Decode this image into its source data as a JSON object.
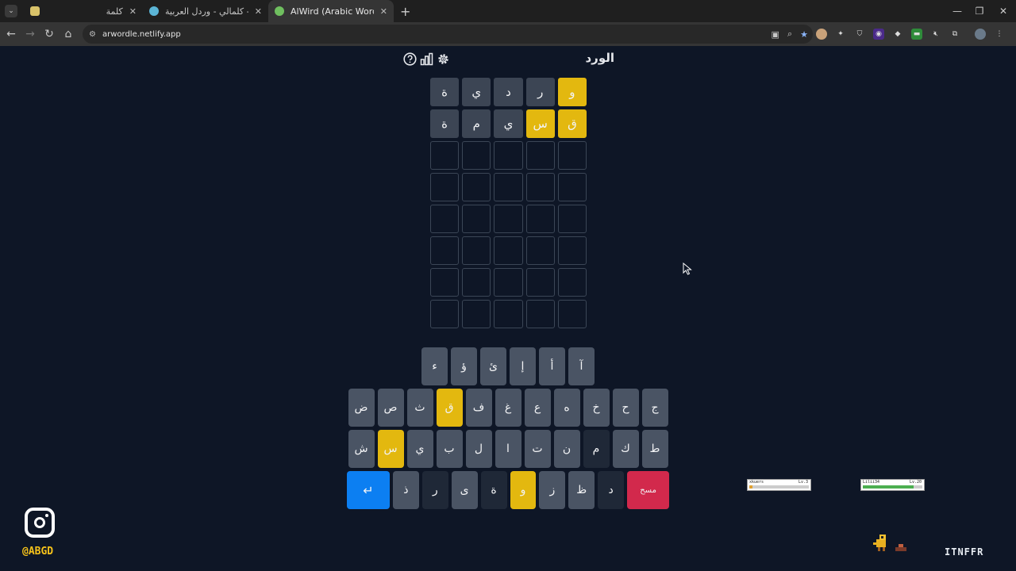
{
  "browser": {
    "tabs": [
      {
        "title": "كلمة",
        "favicon_color": "#d9c36a",
        "active": false
      },
      {
        "title": "كلمالي - وردل العربية - aly.com",
        "favicon_color": "#5bb5d6",
        "active": false
      },
      {
        "title": "AlWird (Arabic Wordle) - الورد",
        "favicon_color": "#6fbf5f",
        "active": true
      }
    ],
    "url": "arwordle.netlify.app"
  },
  "game": {
    "title": "الورد",
    "board": [
      [
        {
          "l": "و",
          "s": "present"
        },
        {
          "l": "ر",
          "s": "absent"
        },
        {
          "l": "د",
          "s": "absent"
        },
        {
          "l": "ي",
          "s": "absent"
        },
        {
          "l": "ة",
          "s": "absent"
        }
      ],
      [
        {
          "l": "ق",
          "s": "present"
        },
        {
          "l": "س",
          "s": "present"
        },
        {
          "l": "ي",
          "s": "absent"
        },
        {
          "l": "م",
          "s": "absent"
        },
        {
          "l": "ة",
          "s": "absent"
        }
      ],
      [],
      [],
      [],
      [],
      [],
      []
    ],
    "keyboard": [
      [
        {
          "k": "آ"
        },
        {
          "k": "أ"
        },
        {
          "k": "إ"
        },
        {
          "k": "ئ"
        },
        {
          "k": "ؤ"
        },
        {
          "k": "ء"
        }
      ],
      [
        {
          "k": "ج"
        },
        {
          "k": "ح"
        },
        {
          "k": "خ"
        },
        {
          "k": "ه"
        },
        {
          "k": "ع"
        },
        {
          "k": "غ"
        },
        {
          "k": "ف"
        },
        {
          "k": "ق",
          "s": "present"
        },
        {
          "k": "ث"
        },
        {
          "k": "ص"
        },
        {
          "k": "ض"
        }
      ],
      [
        {
          "k": "ط"
        },
        {
          "k": "ك"
        },
        {
          "k": "م",
          "s": "dark"
        },
        {
          "k": "ن"
        },
        {
          "k": "ت"
        },
        {
          "k": "ا"
        },
        {
          "k": "ل"
        },
        {
          "k": "ب"
        },
        {
          "k": "ي"
        },
        {
          "k": "س",
          "s": "present"
        },
        {
          "k": "ش"
        }
      ],
      [
        {
          "k": "مسح",
          "s": "delete"
        },
        {
          "k": "د",
          "s": "dark"
        },
        {
          "k": "ظ"
        },
        {
          "k": "ز"
        },
        {
          "k": "و",
          "s": "present"
        },
        {
          "k": "ة",
          "s": "dark"
        },
        {
          "k": "ى"
        },
        {
          "k": "ر",
          "s": "dark"
        },
        {
          "k": "ذ"
        },
        {
          "k": "↵",
          "s": "enter"
        }
      ]
    ]
  },
  "overlay": {
    "handle": "@ABGD",
    "brand": "ITNFFR",
    "players": [
      {
        "name": "xkuers",
        "level": "Lv.3",
        "hp": 0.05,
        "hp_color": "#e0a030"
      },
      {
        "name": "Lilii34",
        "level": "Lv.20",
        "hp": 0.85,
        "hp_color": "#4caf50"
      }
    ]
  },
  "colors": {
    "present": "#e3b80f",
    "absent": "#3c4554",
    "key": "#4a5464",
    "enter": "#0c7ff2",
    "delete": "#d2294c"
  }
}
